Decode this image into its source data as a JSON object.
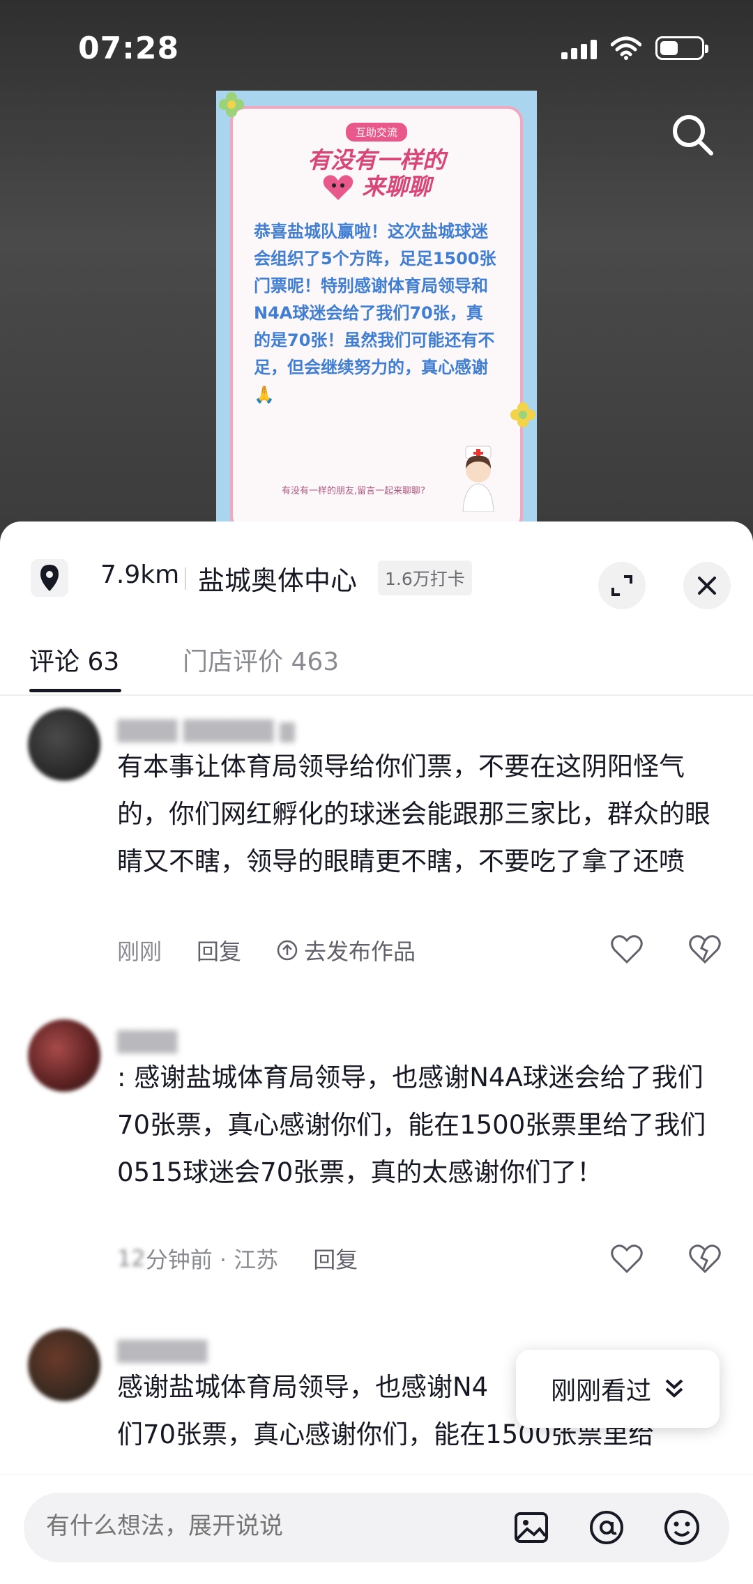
{
  "status_bar": {
    "time": "07:28"
  },
  "poster": {
    "tag": "互助交流",
    "title_line1": "有没有一样的",
    "title_line2": "来聊聊",
    "body": "恭喜盐城队赢啦！这次盐城球迷会组织了5个方阵，足足1500张门票呢！特别感谢体育局领导和N4A球迷会给了我们70张，真的是70张！虽然我们可能还有不足，但会继续努力的，真心感谢🙏",
    "footer": "有没有一样的朋友,留言一起来聊聊?"
  },
  "location": {
    "distance": "7.9km",
    "name": "盐城奥体中心",
    "checkins": "1.6万打卡"
  },
  "tabs": {
    "comments": "评论 63",
    "reviews": "门店评价 463"
  },
  "comments": [
    {
      "text": "有本事让体育局领导给你们票，不要在这阴阳怪气的，你们网红孵化的球迷会能跟那三家比，群众的眼睛又不瞎，领导的眼睛更不瞎，不要吃了拿了还喷",
      "time": "刚刚",
      "reply": "回复",
      "publish": "去发布作品"
    },
    {
      "text": ": 感谢盐城体育局领导，也感谢N4A球迷会给了我们70张票，真心感谢你们，能在1500张票里给了我们0515球迷会70张票，真的太感谢你们了！",
      "time": "分钟前 · 江苏",
      "reply": "回复"
    },
    {
      "text_line1": "感谢盐城体育局领导，也感谢N4",
      "text_line2": "们70张票，真心感谢你们，能在1500张票里给"
    }
  ],
  "recent_viewed": "刚刚看过",
  "input": {
    "placeholder": "有什么想法，展开说说"
  },
  "colors": {
    "poster_bg": "#a9d5ee",
    "poster_border": "#f0a7c0",
    "poster_title": "#d94577",
    "poster_text": "#3f7ed3"
  },
  "icons": [
    "search-icon",
    "location-pin-icon",
    "expand-icon",
    "close-icon",
    "publish-icon",
    "heart-icon",
    "broken-heart-icon",
    "chevron-down-icon",
    "image-icon",
    "at-icon",
    "emoji-icon"
  ]
}
